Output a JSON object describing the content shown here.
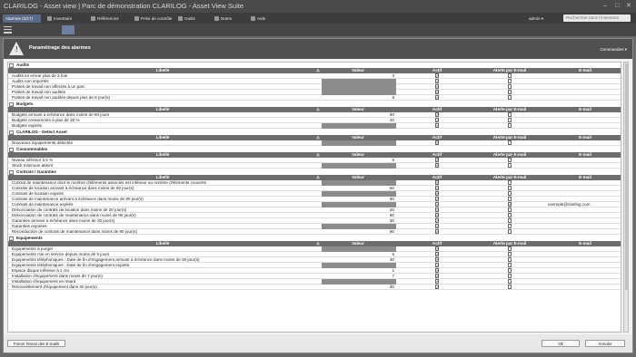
{
  "window": {
    "title": "CLARILOG - Asset view | Parc de démonstration CLARILOG - Asset View Suite"
  },
  "menu": {
    "active_tab": "Alarmes (3/17)",
    "items": [
      {
        "label": "Inventaire",
        "icon": "inventory-icon"
      },
      {
        "label": "Références",
        "icon": "references-icon"
      },
      {
        "label": "Prise de contrôle",
        "icon": "remote-control-icon"
      },
      {
        "label": "Outils",
        "icon": "tools-icon"
      },
      {
        "label": "Notes",
        "icon": "notes-icon"
      },
      {
        "label": "Aide",
        "icon": "help-icon"
      }
    ],
    "user": "admin",
    "search_placeholder": "Rechercher dans l'inventaire"
  },
  "dialog": {
    "title": "Paramétrage des alarmes",
    "commands": "Commandes"
  },
  "columns": {
    "libelle": "Libellé",
    "valeur": "Valeur",
    "actif": "Actif",
    "alerte": "Alerte par E-mail",
    "email": "E-mail"
  },
  "sections": [
    {
      "title": "Audits",
      "rows": [
        {
          "label": "Audits en erreur plus de 3 fois",
          "value": "3",
          "actif": true,
          "alert": false,
          "email": ""
        },
        {
          "label": "Audits non importés",
          "value": "",
          "actif": true,
          "alert": false,
          "email": ""
        },
        {
          "label": "Postes de travail non affectés à un parc",
          "value": "",
          "actif": true,
          "alert": false,
          "email": ""
        },
        {
          "label": "Postes de travail non audités",
          "value": "",
          "actif": true,
          "alert": false,
          "email": ""
        },
        {
          "label": "Postes de travail non audités depuis plus de 8 jour(s)",
          "value": "8",
          "actif": true,
          "alert": false,
          "email": ""
        }
      ]
    },
    {
      "title": "Budgets",
      "rows": [
        {
          "label": "Budgets arrivant à échéance dans moins de 90 jours",
          "value": "90",
          "actif": true,
          "alert": false,
          "email": ""
        },
        {
          "label": "Budgets consommés à plus de 20 %",
          "value": "20",
          "actif": true,
          "alert": false,
          "email": ""
        },
        {
          "label": "Budgets expirés",
          "value": "",
          "actif": true,
          "alert": false,
          "email": ""
        }
      ]
    },
    {
      "title": "CLARILOG - Detect Asset",
      "rows": [
        {
          "label": "Nouveaux équipements détectés",
          "value": "",
          "actif": true,
          "alert": false,
          "email": ""
        }
      ]
    },
    {
      "title": "Consommables",
      "rows": [
        {
          "label": "Niveau inférieur à 5 %",
          "value": "5",
          "actif": true,
          "alert": false,
          "email": ""
        },
        {
          "label": "Stock minimum atteint",
          "value": "",
          "actif": true,
          "alert": false,
          "email": ""
        }
      ]
    },
    {
      "title": "Contrats / Garanties",
      "rows": [
        {
          "label": "Contrat de maintenance dont le nombre d'éléments associés est inférieur au nombre d'éléments couverts",
          "value": "",
          "actif": true,
          "alert": false,
          "email": ""
        },
        {
          "label": "Contrats de location arrivant à échéance dans moins de 60 jour(s)",
          "value": "60",
          "actif": true,
          "alert": false,
          "email": ""
        },
        {
          "label": "Contrats de location expirés",
          "value": "",
          "actif": true,
          "alert": false,
          "email": ""
        },
        {
          "label": "Contrats de maintenance arrivant à échéance dans moins de 90 jour(s)",
          "value": "90",
          "actif": true,
          "alert": false,
          "email": ""
        },
        {
          "label": "Contrats de maintenance expirés",
          "value": "",
          "actif": true,
          "alert": true,
          "email": "exemple@clarilog.com"
        },
        {
          "label": "Dénonciation de contrats de location dans moins de 20 jour(s)",
          "value": "20",
          "actif": true,
          "alert": false,
          "email": ""
        },
        {
          "label": "Dénonciation de contrats de maintenance dans moins de 90 jour(s)",
          "value": "90",
          "actif": true,
          "alert": false,
          "email": ""
        },
        {
          "label": "Garanties arrivant à échéance dans moins de 30 jour(s)",
          "value": "30",
          "actif": true,
          "alert": false,
          "email": ""
        },
        {
          "label": "Garanties expirées",
          "value": "",
          "actif": true,
          "alert": false,
          "email": ""
        },
        {
          "label": "Reconduction de contrats de maintenance dans moins de 90 jour(s)",
          "value": "90",
          "actif": true,
          "alert": false,
          "email": ""
        }
      ]
    },
    {
      "title": "Equipements",
      "rows": [
        {
          "label": "Equipements à purger",
          "value": "",
          "actif": true,
          "alert": false,
          "email": ""
        },
        {
          "label": "Equipements mis en service depuis moins de 5 jours",
          "value": "5",
          "actif": true,
          "alert": false,
          "email": ""
        },
        {
          "label": "Equipements téléphoniques : Date de fin d'engagement arrivant à échéance dans moins de 30 jour(s)",
          "value": "30",
          "actif": true,
          "alert": false,
          "email": ""
        },
        {
          "label": "Equipements téléphoniques : Date de fin d'engagement expirée",
          "value": "",
          "actif": true,
          "alert": false,
          "email": ""
        },
        {
          "label": "Espace disque inférieur à 1 Go",
          "value": "1",
          "actif": true,
          "alert": false,
          "email": ""
        },
        {
          "label": "Installation d'équipement dans moins de 7 jour(s)",
          "value": "7",
          "actif": true,
          "alert": false,
          "email": ""
        },
        {
          "label": "Installation d'équipement en retard",
          "value": "",
          "actif": true,
          "alert": false,
          "email": ""
        },
        {
          "label": "Renouvellement d'équipement dans 30 jour(s)",
          "value": "30",
          "actif": true,
          "alert": false,
          "email": ""
        }
      ]
    }
  ],
  "footer": {
    "force_label": "Forcer l'envoi des E-mails",
    "ok_label": "Ok",
    "cancel_label": "Annuler"
  }
}
